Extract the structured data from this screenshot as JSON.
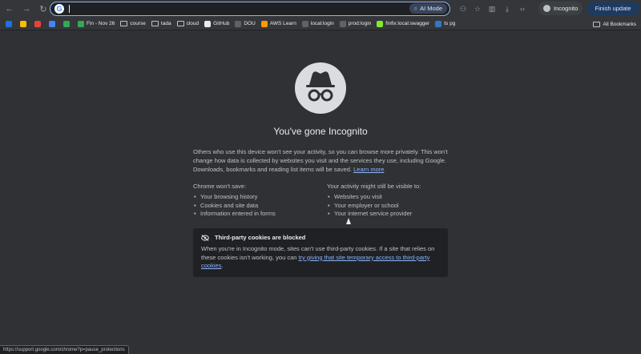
{
  "toolbar": {
    "back_icon": "arrow-left-icon",
    "forward_icon": "arrow-right-icon",
    "reload_icon": "reload-icon",
    "omnibox_value": "",
    "ai_mode_label": "AI Mode",
    "incognito_label": "Incognito",
    "finish_update_label": "Finish update"
  },
  "bookmarks": [
    {
      "label": "",
      "color": "#1a73e8"
    },
    {
      "label": "",
      "color": "#fbbc04"
    },
    {
      "label": "",
      "color": "#ea4335"
    },
    {
      "label": "",
      "color": "#4285f4"
    },
    {
      "label": "",
      "color": "#34a853"
    },
    {
      "label": "Fin - Nov 26",
      "color": "#34a853"
    },
    {
      "label": "course",
      "folder": true
    },
    {
      "label": "tada",
      "folder": true
    },
    {
      "label": "cloud",
      "folder": true
    },
    {
      "label": "GitHub",
      "color": "#e8eaed"
    },
    {
      "label": "DOU",
      "color": "#5f6368"
    },
    {
      "label": "AWS Learn",
      "color": "#ff9900"
    },
    {
      "label": "local:login",
      "color": "#5f6368"
    },
    {
      "label": "prod:login",
      "color": "#5f6368"
    },
    {
      "label": "finfix:local:swagger",
      "color": "#85ea2d"
    },
    {
      "label": "ts pg",
      "color": "#3178c6"
    }
  ],
  "all_bookmarks_label": "All Bookmarks",
  "main": {
    "title": "You've gone Incognito",
    "intro": "Others who use this device won't see your activity, so you can browse more privately. This won't change how data is collected by websites you visit and the services they use, including Google. Downloads, bookmarks and reading list items will be saved.",
    "learn_more": "Learn more",
    "wont_save_heading": "Chrome won't save:",
    "wont_save_items": [
      "Your browsing history",
      "Cookies and site data",
      "Information entered in forms"
    ],
    "visible_heading": "Your activity might still be visible to:",
    "visible_items": [
      "Websites you visit",
      "Your employer or school",
      "Your internet service provider"
    ],
    "cookies_heading": "Third-party cookies are blocked",
    "cookies_body": "When you're in Incognito mode, sites can't use third-party cookies. If a site that relies on these cookies isn't working, you can",
    "cookies_link": "try giving that site temporary access to third-party cookies",
    "cookies_end": "."
  },
  "status_url": "https://support.google.com/chrome?p=pause_protections"
}
